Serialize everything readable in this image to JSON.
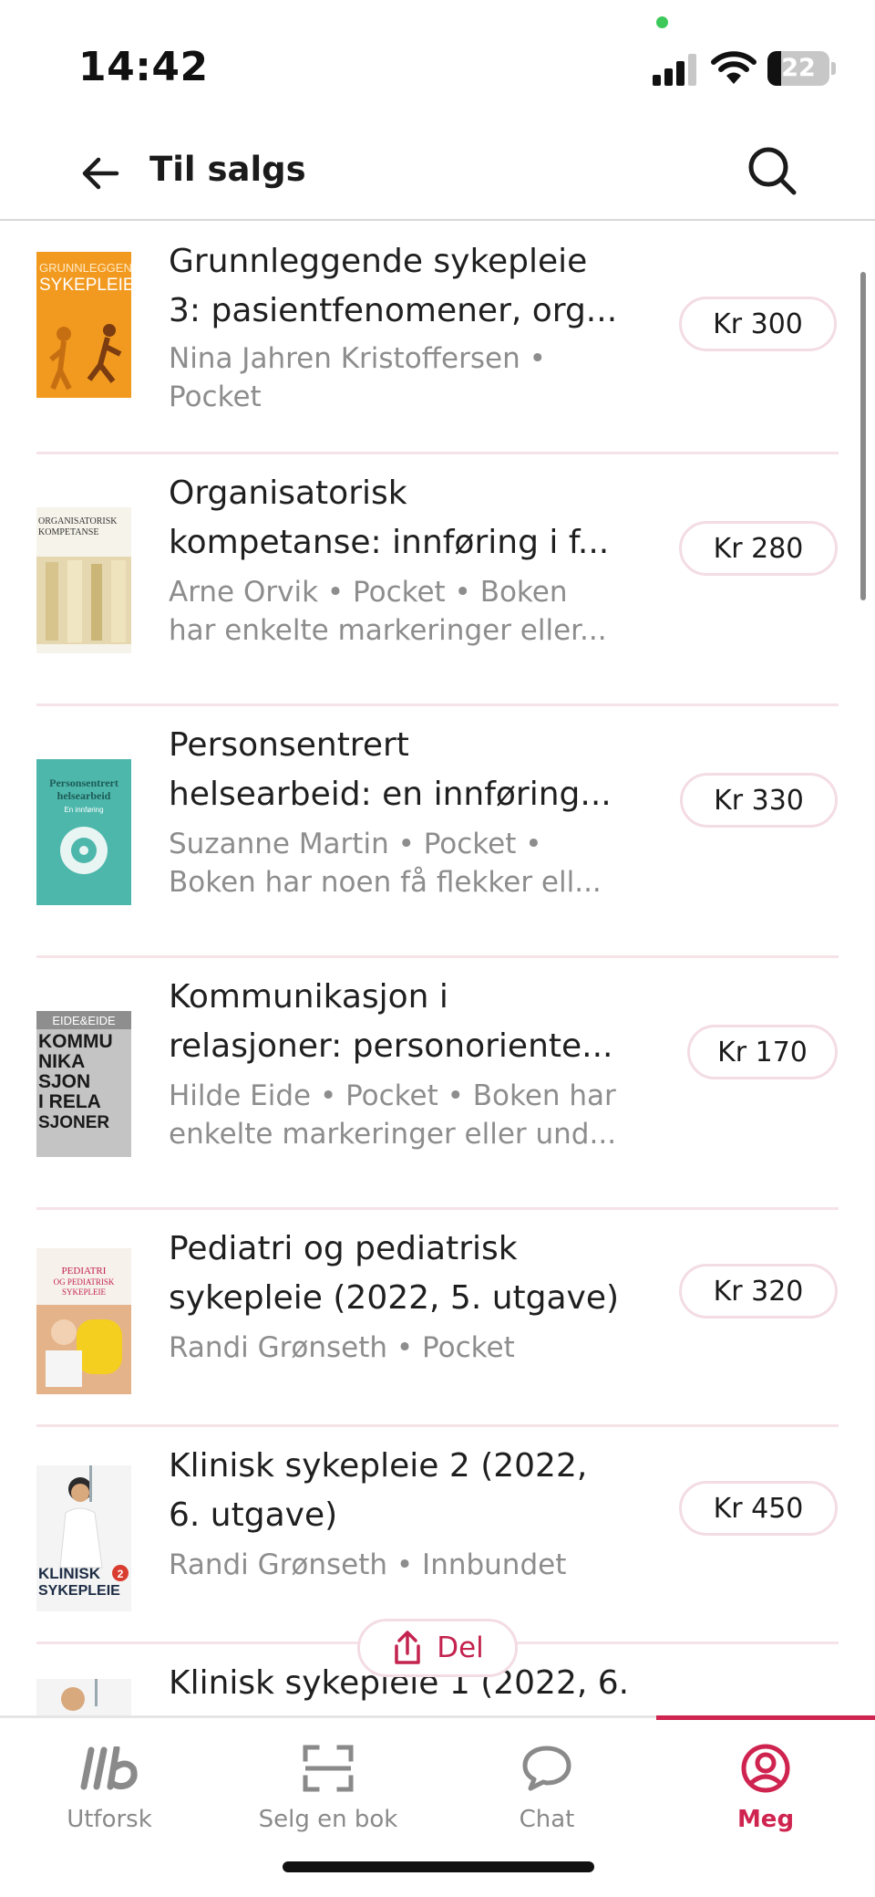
{
  "status_bar": {
    "time": "14:42",
    "battery": "22"
  },
  "header": {
    "title": "Til salgs",
    "back_icon": "arrow-left-icon",
    "search_icon": "search-icon"
  },
  "books": [
    {
      "title_lines": [
        "Grunnleggende sykepleie",
        "3: pasientfenomener, org..."
      ],
      "meta_lines": [
        "Nina Jahren Kristoffersen •",
        "Pocket"
      ],
      "price": "Kr 300",
      "cover": {
        "bg": "#f29a1f",
        "line1": "GRUNNLEGGENDE",
        "line2": "SYKEPLEIE"
      }
    },
    {
      "title_lines": [
        "Organisatorisk",
        "kompetanse: innføring i f..."
      ],
      "meta_lines": [
        "Arne Orvik • Pocket • Boken",
        "har enkelte markeringer eller..."
      ],
      "price": "Kr 280",
      "cover": {
        "bg": "#f3efe4",
        "line1": "ORGANISATORISK",
        "line2": "KOMPETANSE"
      }
    },
    {
      "title_lines": [
        "Personsentrert",
        "helsearbeid: en innføring..."
      ],
      "meta_lines": [
        "Suzanne Martin • Pocket •",
        "Boken har noen få flekker ell..."
      ],
      "price": "Kr 330",
      "cover": {
        "bg": "#4db7ac",
        "line1": "Personsentrert",
        "line2": "helsearbeid",
        "line3": "En innføring"
      }
    },
    {
      "title_lines": [
        "Kommunikasjon i",
        "relasjoner: personoriente..."
      ],
      "meta_lines": [
        "Hilde Eide • Pocket • Boken har",
        "enkelte markeringer eller und..."
      ],
      "price": "Kr 170",
      "cover": {
        "bg": "#c4c4c4",
        "line1": "EIDE&EIDE",
        "line2": "KOMMU",
        "line3": "NIKA",
        "line4": "SJON",
        "line5": "I RELA",
        "line6": "SJONER"
      }
    },
    {
      "title_lines": [
        "Pediatri og pediatrisk",
        "sykepleie (2022, 5. utgave)"
      ],
      "meta_lines": [
        "Randi Grønseth • Pocket"
      ],
      "price": "Kr 320",
      "cover": {
        "bg": "#f6f1ea",
        "line1": "PEDIATRI",
        "line2": "OG PEDIATRISK",
        "line3": "SYKEPLEIE"
      }
    },
    {
      "title_lines": [
        "Klinisk sykepleie 2 (2022,",
        "6. utgave)"
      ],
      "meta_lines": [
        "Randi Grønseth • Innbundet"
      ],
      "price": "Kr 450",
      "cover": {
        "bg": "#f4f4f4",
        "line1": "KLINISK",
        "line2": "SYKEPLEIE",
        "badge": "2"
      }
    },
    {
      "title_lines": [
        "Klinisk sykepleie 1 (2022, 6."
      ],
      "meta_lines": [],
      "price": "",
      "cover": {
        "bg": "#f4f4f4"
      }
    }
  ],
  "share": {
    "label": "Del",
    "icon": "share-icon"
  },
  "tabs": [
    {
      "label": "Utforsk",
      "icon": "explore-logo-icon",
      "active": false
    },
    {
      "label": "Selg en bok",
      "icon": "scan-icon",
      "active": false
    },
    {
      "label": "Chat",
      "icon": "chat-bubble-icon",
      "active": false
    },
    {
      "label": "Meg",
      "icon": "profile-icon",
      "active": true
    }
  ],
  "colors": {
    "accent": "#cf2450",
    "divider": "#f5e3e8",
    "price_border": "#f3dce3",
    "muted_text": "#8d8d8d"
  }
}
